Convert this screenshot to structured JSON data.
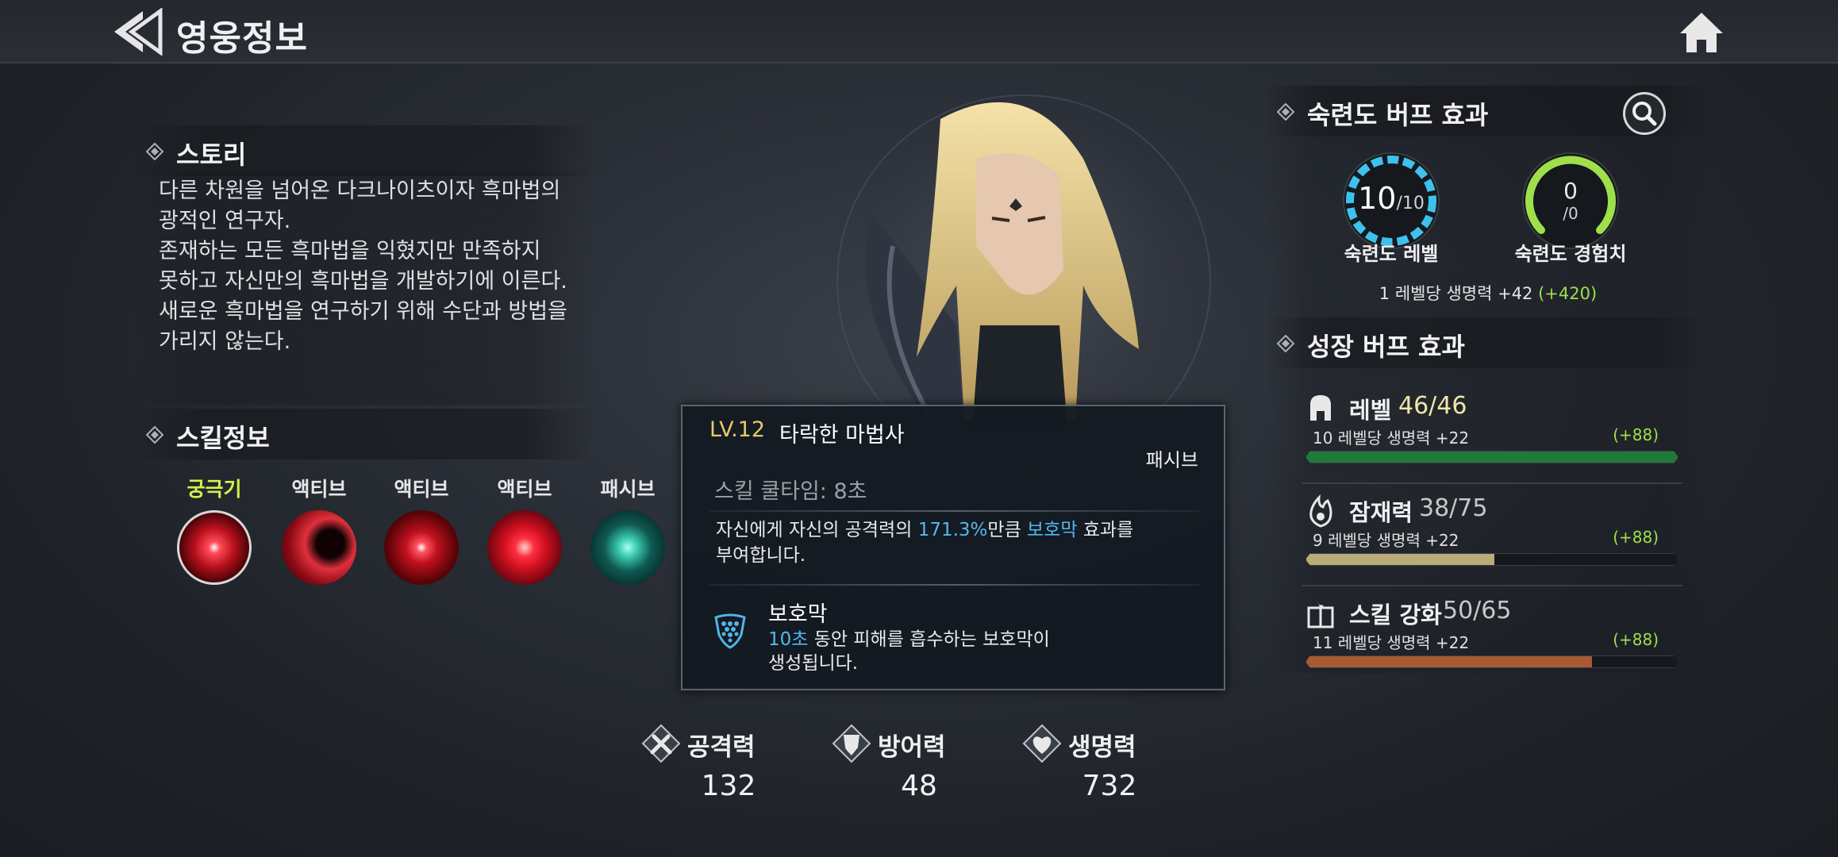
{
  "header": {
    "title": "영웅정보",
    "back_icon": "double-chevron-left-icon",
    "home_icon": "home-icon"
  },
  "story": {
    "title": "스토리",
    "lines": [
      "다른 차원을 넘어온 다크나이츠이자 흑마법의",
      "광적인 연구자.",
      "존재하는 모든 흑마법을 익혔지만 만족하지",
      "못하고 자신만의 흑마법을 개발하기에 이른다.",
      "새로운 흑마법을 연구하기 위해 수단과 방법을",
      "가리지 않는다."
    ]
  },
  "skills": {
    "title": "스킬정보",
    "items": [
      {
        "type": "궁극기",
        "icon": "ultimate-skill-icon",
        "color": "#d7f04a"
      },
      {
        "type": "액티브",
        "icon": "active-skill-1-icon"
      },
      {
        "type": "액티브",
        "icon": "active-skill-2-icon"
      },
      {
        "type": "액티브",
        "icon": "active-skill-3-icon"
      },
      {
        "type": "패시브",
        "icon": "passive-skill-icon"
      }
    ]
  },
  "tooltip": {
    "level": "LV.12",
    "name": "타락한 마법사",
    "kind": "패시브",
    "cooldown": "스킬 쿨타임: 8초",
    "desc_part1": "자신에게 자신의 공격력의 ",
    "desc_highlight1": "171.3%",
    "desc_part2": "만큼 ",
    "desc_highlight2": "보호막",
    "desc_part3": " 효과를",
    "desc_line2": "부여합니다.",
    "effect_title": "보호막",
    "effect_highlight": "10초",
    "effect_desc1": " 동안 피해를 흡수하는 보호막이",
    "effect_desc2": "생성됩니다."
  },
  "stats": [
    {
      "name": "공격력",
      "value": "132",
      "icon": "attack-icon"
    },
    {
      "name": "방어력",
      "value": "48",
      "icon": "defense-icon"
    },
    {
      "name": "생명력",
      "value": "732",
      "icon": "health-icon"
    }
  ],
  "mastery": {
    "title": "숙련도 버프 효과",
    "search_icon": "search-icon",
    "level": {
      "current": "10",
      "max": "/10",
      "label": "숙련도 레벨",
      "fraction": 1.0,
      "color": "#3ec1ec"
    },
    "exp": {
      "current": "0",
      "max": "/0",
      "label": "숙련도 경험치",
      "fraction": 1.0,
      "color": "#9ee04a"
    },
    "bonus_text": "1 레벨당 생명력 +42",
    "bonus_total": "(+420)"
  },
  "growth": {
    "title": "성장 버프 효과",
    "items": [
      {
        "name": "레벨",
        "value": "46/46",
        "sub": "10 레벨당 생명력 +22",
        "plus": "(+88)",
        "fraction": 1.0,
        "bar_color": "#1f7a3a",
        "value_color": "#f0e7a8",
        "icon": "helmet-icon"
      },
      {
        "name": "잠재력",
        "value": "38/75",
        "sub": "9 레벨당 생명력 +22",
        "plus": "(+88)",
        "fraction": 0.507,
        "bar_color": "#b9ac78",
        "value_color": "#c8c8c8",
        "icon": "flame-icon"
      },
      {
        "name": "스킬 강화",
        "value": "50/65",
        "sub": "11 레벨당 생명력 +22",
        "plus": "(+88)",
        "fraction": 0.769,
        "bar_color": "#a85a34",
        "value_color": "#c8c8c8",
        "icon": "book-icon"
      }
    ]
  }
}
